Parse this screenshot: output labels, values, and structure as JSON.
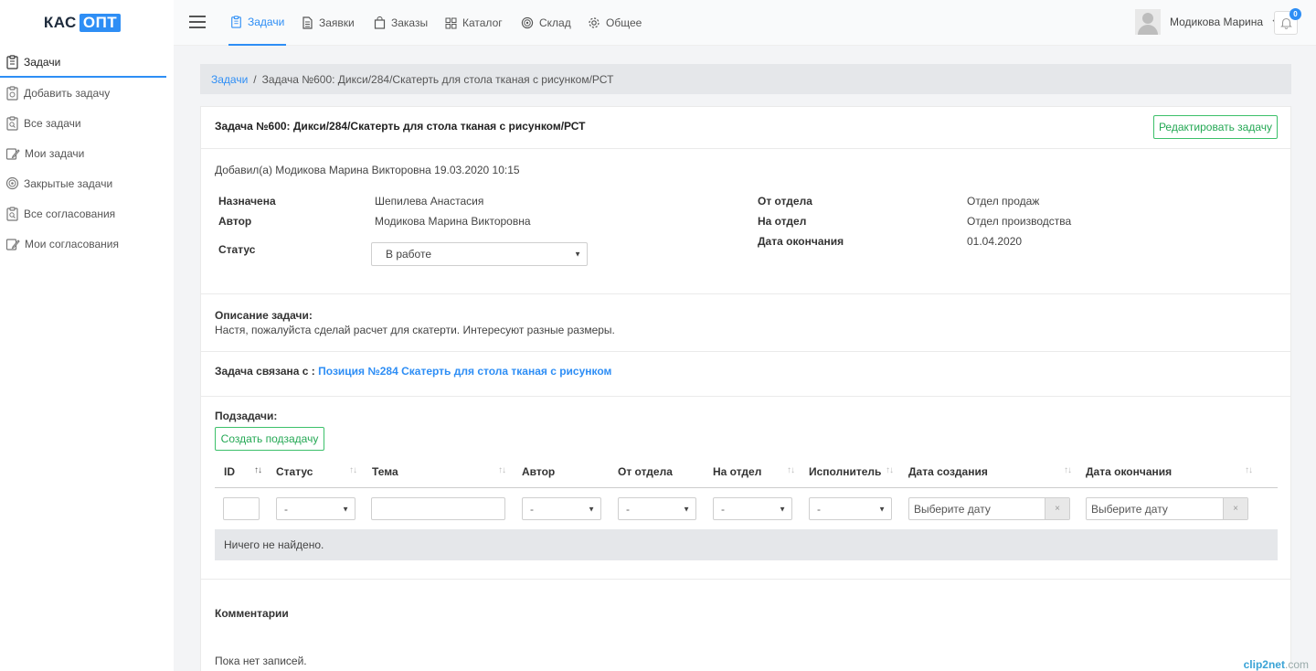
{
  "logo": {
    "part1": "КАС",
    "part2": "ОПТ"
  },
  "sidebar": {
    "items": [
      {
        "label": "Задачи"
      },
      {
        "label": "Добавить задачу"
      },
      {
        "label": "Все задачи"
      },
      {
        "label": "Мои задачи"
      },
      {
        "label": "Закрытые задачи"
      },
      {
        "label": "Все согласования"
      },
      {
        "label": "Мои согласования"
      }
    ]
  },
  "nav": {
    "tabs": [
      {
        "label": "Задачи"
      },
      {
        "label": "Заявки"
      },
      {
        "label": "Заказы"
      },
      {
        "label": "Каталог"
      },
      {
        "label": "Склад"
      },
      {
        "label": "Общее"
      }
    ]
  },
  "user": {
    "name": "Модикова Марина",
    "notifications": "0"
  },
  "breadcrumb": {
    "root": "Задачи",
    "separator": "/",
    "current": "Задача №600: Дикси/284/Скатерть для стола тканая с рисунком/РСТ"
  },
  "task": {
    "title": "Задача №600: Дикси/284/Скатерть для стола тканая с рисунком/РСТ",
    "edit_label": "Редактировать задачу",
    "added_by": "Добавил(а) Модикова Марина Викторовна 19.03.2020 10:15",
    "assigned_label": "Назначена",
    "assigned_value": "Шепилева Анастасия",
    "author_label": "Автор",
    "author_value": "Модикова Марина Викторовна",
    "status_label": "Статус",
    "status_value": "В работе",
    "from_dept_label": "От отдела",
    "from_dept_value": "Отдел продаж",
    "to_dept_label": "На отдел",
    "to_dept_value": "Отдел производства",
    "end_date_label": "Дата окончания",
    "end_date_value": "01.04.2020",
    "description_label": "Описание задачи:",
    "description": "Настя, пожалуйста сделай расчет для скатерти. Интересуют разные размеры.",
    "linked_label": "Задача связана с :",
    "linked_value": "Позиция №284 Скатерть для стола тканая с рисунком"
  },
  "subtasks": {
    "title": "Подзадачи:",
    "create_label": "Создать подзадачу",
    "columns": [
      "ID",
      "Статус",
      "Тема",
      "Автор",
      "От отдела",
      "На отдел",
      "Исполнитель",
      "Дата создания",
      "Дата окончания"
    ],
    "filter_select_value": "-",
    "date_placeholder": "Выберите дату",
    "clear_symbol": "×",
    "empty_text": "Ничего не найдено."
  },
  "comments": {
    "title": "Комментарии",
    "empty_text": "Пока нет записей."
  },
  "watermark": {
    "part1": "clip2net",
    "part2": ".com"
  },
  "colors": {
    "accent": "#2e8ef5",
    "success": "#3cc06a",
    "sidebar_bg": "#ffffff",
    "page_bg": "#f3f4f6"
  }
}
